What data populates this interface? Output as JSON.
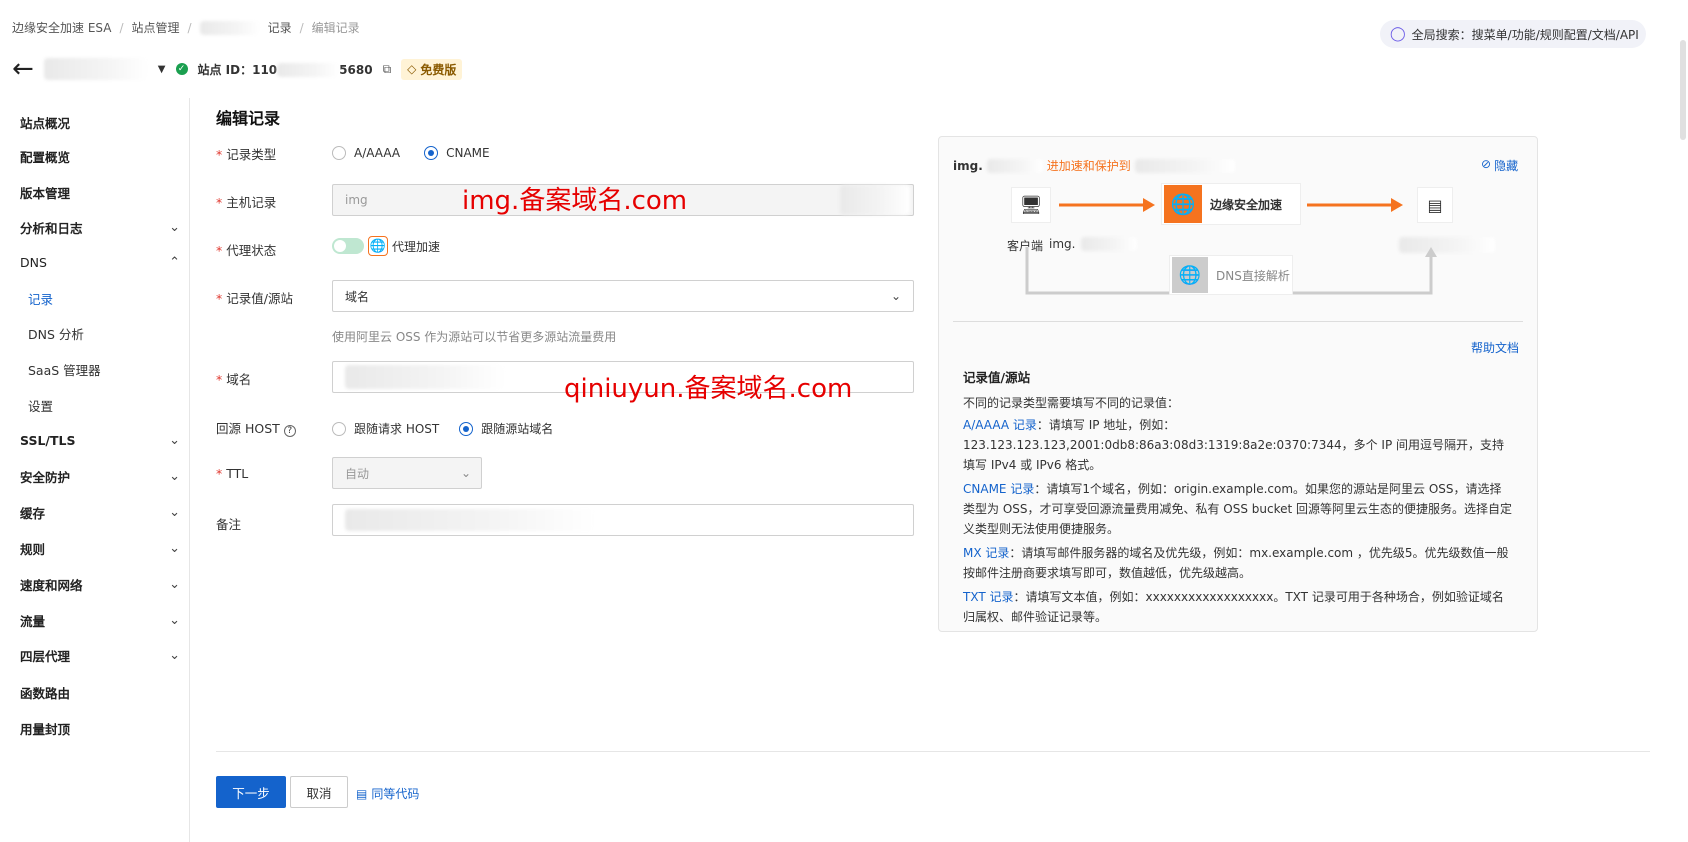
{
  "breadcrumb": {
    "root": "边缘安全加速 ESA",
    "sites": "站点管理",
    "records": "记录",
    "current": "编辑记录"
  },
  "global_search": {
    "label": "全局搜索：搜菜单/功能/规则配置/文档/API"
  },
  "site": {
    "id_label": "站点 ID：",
    "id_prefix": "110",
    "id_suffix": "5680",
    "plan": "免费版"
  },
  "sidebar": {
    "items": [
      {
        "label": "站点概况"
      },
      {
        "label": "配置概览"
      },
      {
        "label": "版本管理"
      },
      {
        "label": "分析和日志"
      },
      {
        "label": "DNS"
      },
      {
        "label": "记录"
      },
      {
        "label": "DNS 分析"
      },
      {
        "label": "SaaS 管理器"
      },
      {
        "label": "设置"
      },
      {
        "label": "SSL/TLS"
      },
      {
        "label": "安全防护"
      },
      {
        "label": "缓存"
      },
      {
        "label": "规则"
      },
      {
        "label": "速度和网络"
      },
      {
        "label": "流量"
      },
      {
        "label": "四层代理"
      },
      {
        "label": "函数路由"
      },
      {
        "label": "用量封顶"
      }
    ]
  },
  "form": {
    "title": "编辑记录",
    "record_type": {
      "label": "记录类型",
      "option_a": "A/AAAA",
      "option_cname": "CNAME",
      "selected": "CNAME"
    },
    "host_record": {
      "label": "主机记录",
      "value": "img"
    },
    "proxy_status": {
      "label": "代理状态",
      "value": "代理加速"
    },
    "record_value": {
      "label": "记录值/源站",
      "value": "域名",
      "hint": "使用阿里云 OSS 作为源站可以节省更多源站流量费用"
    },
    "domain": {
      "label": "域名"
    },
    "origin_host": {
      "label": "回源 HOST",
      "option_request": "跟随请求 HOST",
      "option_origin": "跟随源站域名",
      "selected": "跟随源站域名"
    },
    "ttl": {
      "label": "TTL",
      "value": "自动"
    },
    "remark": {
      "label": "备注"
    }
  },
  "watermarks": {
    "first": "img.备案域名.com",
    "second": "qiniuyun.备案域名.com"
  },
  "panel": {
    "domain_prefix": "img.",
    "flow_text": "进加速和保护到",
    "hide": "隐藏",
    "client": "客户端",
    "client_domain": "img.",
    "esa": "边缘安全加速",
    "dns_direct": "DNS直接解析",
    "help": "帮助文档",
    "heading": "记录值/源站",
    "intro": "不同的记录类型需要填写不同的记录值：",
    "a_title": "A/AAAA 记录",
    "a_text": "：请填写 IP 地址，例如：123.123.123.123,2001:0db8:86a3:08d3:1319:8a2e:0370:7344，多个 IP 间用逗号隔开，支持填写 IPv4 或 IPv6 格式。",
    "cname_title": "CNAME 记录",
    "cname_text": "：请填写1个域名，例如：origin.example.com。如果您的源站是阿里云 OSS，请选择类型为 OSS，才可享受回源流量费用减免、私有 OSS bucket 回源等阿里云生态的便捷服务。选择自定义类型则无法使用便捷服务。",
    "mx_title": "MX 记录",
    "mx_text": "：请填写邮件服务器的域名及优先级，例如：mx.example.com ，优先级5。优先级数值一般按邮件注册商要求填写即可，数值越低，优先级越高。",
    "txt_title": "TXT 记录",
    "txt_text": "：请填写文本值，例如：xxxxxxxxxxxxxxxxxx。TXT 记录可用于各种场合，例如验证域名归属权、邮件验证记录等。"
  },
  "footer": {
    "next": "下一步",
    "cancel": "取消",
    "code": "同等代码"
  },
  "colors": {
    "primary": "#1463cc",
    "accent": "#f5731f",
    "required": "#e0382f",
    "watermark": "#e60000"
  }
}
